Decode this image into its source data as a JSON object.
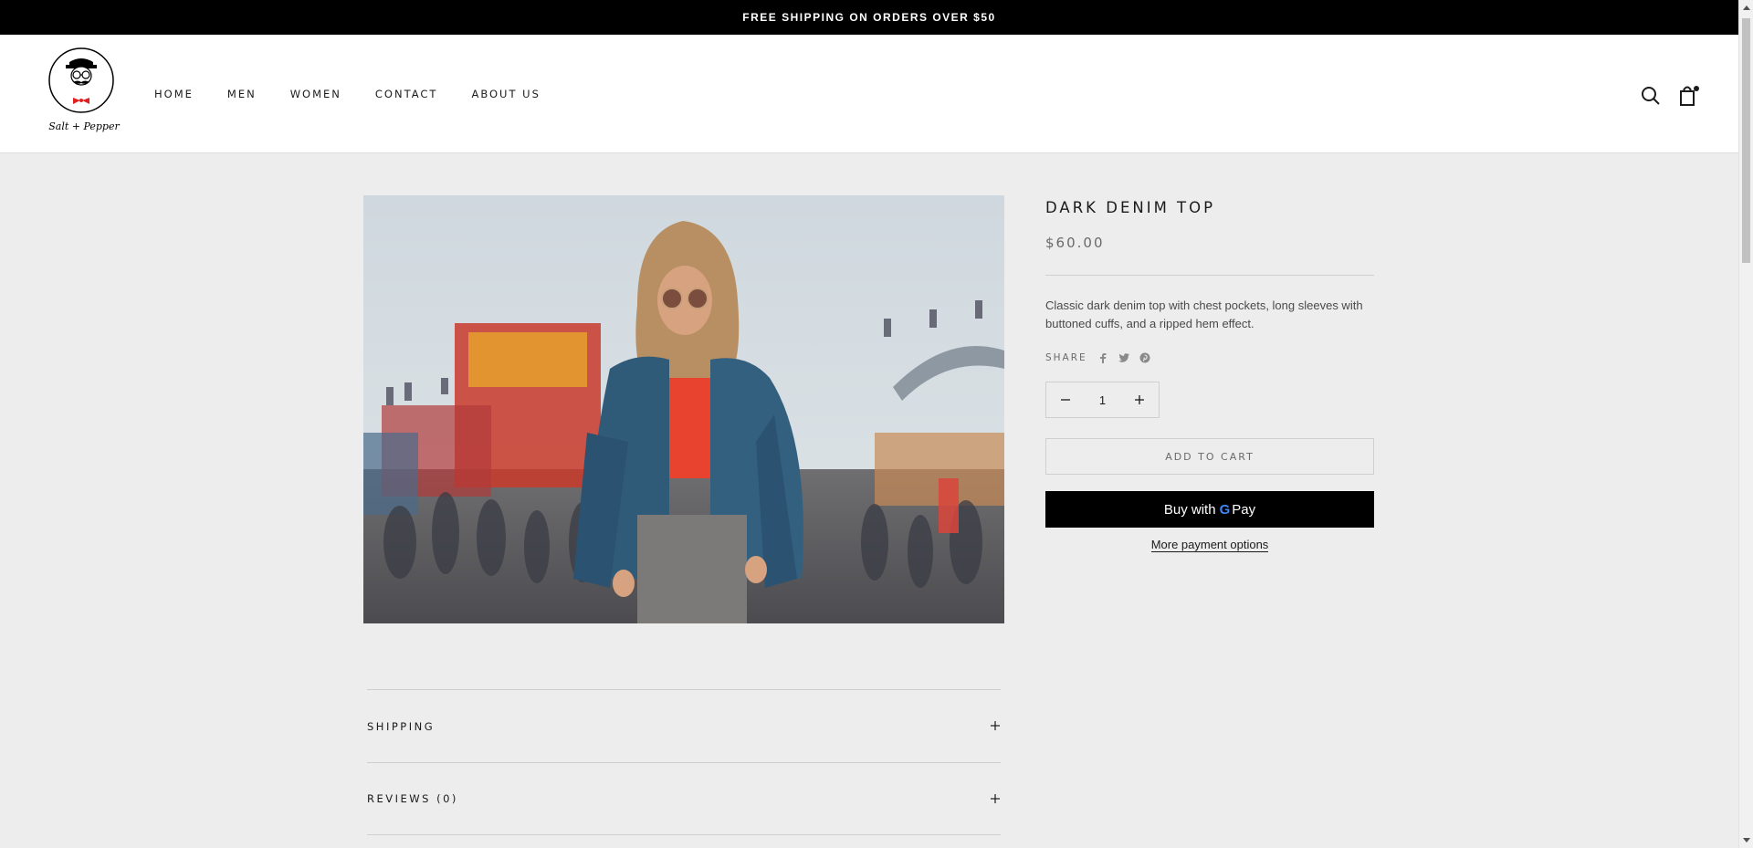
{
  "announcement": {
    "text": "FREE SHIPPING ON ORDERS OVER $50"
  },
  "header": {
    "logo_text": "Salt + Pepper",
    "nav": [
      "HOME",
      "MEN",
      "WOMEN",
      "CONTACT",
      "ABOUT US"
    ],
    "icons": [
      "search-icon",
      "cart-icon"
    ]
  },
  "product": {
    "image_alt": "Woman in denim jacket at fair",
    "title": "DARK DENIM TOP",
    "price": "$60.00",
    "description": "Classic dark denim top with chest pockets, long sleeves with buttoned cuffs, and a ripped hem effect.",
    "share_label": "SHARE",
    "share_icons": [
      "facebook-icon",
      "twitter-icon",
      "pinterest-icon"
    ],
    "quantity": "1",
    "add_to_cart": "ADD TO CART",
    "gpay_prefix": "Buy with",
    "gpay_g": "G",
    "gpay_suffix": "Pay",
    "more_payment": "More payment options"
  },
  "accordion": [
    {
      "label": "SHIPPING"
    },
    {
      "label": "REVIEWS (0)"
    }
  ],
  "colors": {
    "background": "#ededed",
    "announcement_bg": "#000000",
    "accent_red": "#e02020"
  }
}
